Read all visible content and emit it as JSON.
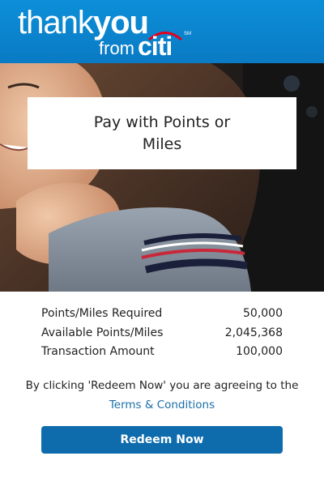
{
  "header": {
    "logo": {
      "thank": "thank",
      "you": "you",
      "from": "from",
      "citi": "citi",
      "sm": "SM"
    },
    "background_color": "#0a7ac4"
  },
  "hero": {
    "title": "Pay with Points or Miles",
    "image": "woman-smiling-photo"
  },
  "details": {
    "rows": [
      {
        "label": "Points/Miles Required",
        "value": "50,000"
      },
      {
        "label": "Available Points/Miles",
        "value": "2,045,368"
      },
      {
        "label": "Transaction Amount",
        "value": "100,000"
      }
    ]
  },
  "agreement": {
    "text": "By clicking 'Redeem Now' you are agreeing to the ",
    "link_label": "Terms & Conditions",
    "link_color": "#1a6fa8"
  },
  "redeem_button": {
    "label": "Redeem Now",
    "color": "#0e6cad"
  }
}
